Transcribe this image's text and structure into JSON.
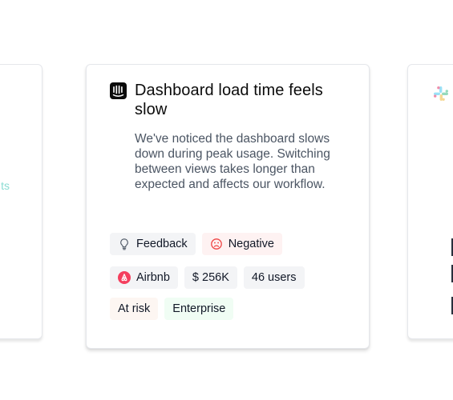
{
  "card": {
    "title": "Dashboard load time feels slow",
    "description": "We've noticed the dashboard slows down during peak usage. Switching between views takes longer than expected and affects our workflow.",
    "source_icon": "intercom-icon"
  },
  "tags": {
    "type_label": "Feedback",
    "sentiment_label": "Negative",
    "company_label": "Airbnb",
    "revenue_label": "$ 256K",
    "users_label": "46 users",
    "status_label": "At risk",
    "plan_label": "Enterprise"
  },
  "icons": {
    "type": "lightbulb-icon",
    "sentiment": "frown-icon",
    "company": "airbnb-icon"
  },
  "side_left": {
    "ghost_text": "ts"
  },
  "side_right": {
    "logo": "slack-icon"
  },
  "colors": {
    "negative": "#ef4444",
    "airbnb": "#f43f5e",
    "at_risk_bg": "#fdf6f2",
    "enterprise_bg": "#f0fdf4",
    "neutral_bg": "#f3f4f6"
  }
}
